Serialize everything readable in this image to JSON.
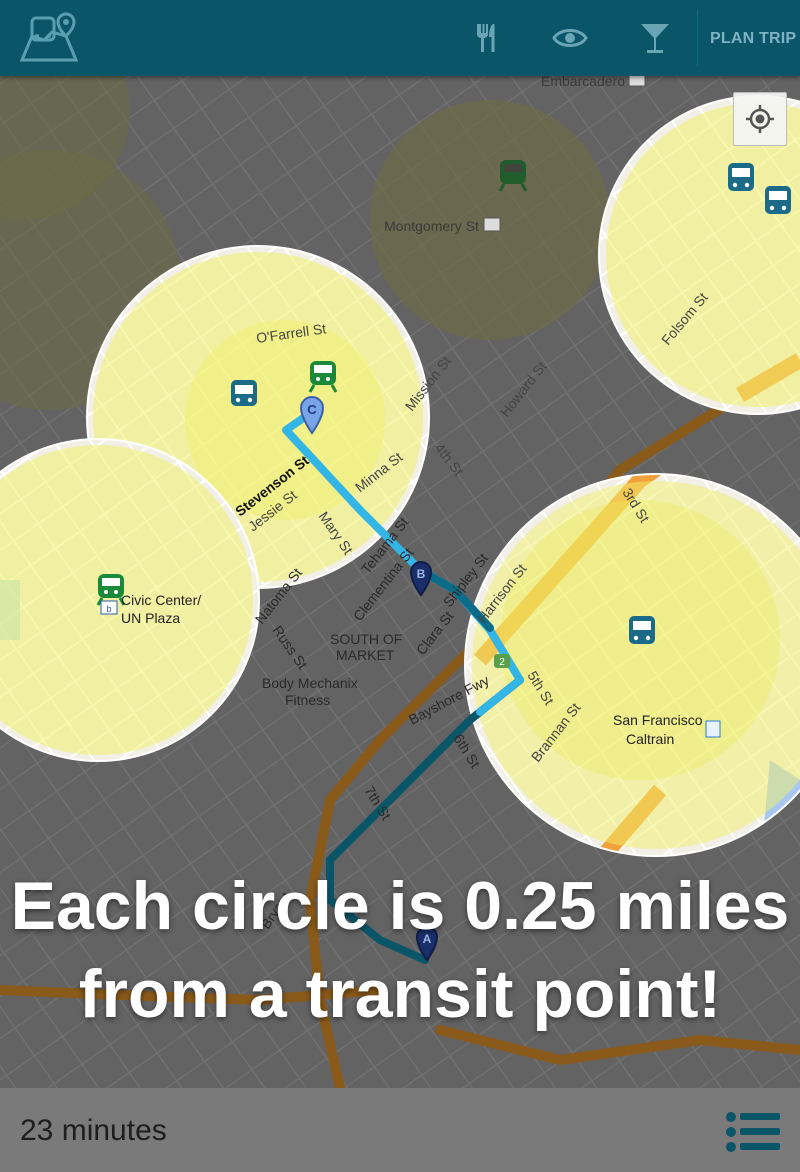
{
  "toolbar": {
    "logo_icon": "transit-map-logo-icon",
    "food_icon": "fork-knife-icon",
    "sights_icon": "eye-icon",
    "bars_icon": "cocktail-icon",
    "plan_trip_label": "PLAN TRIP"
  },
  "map": {
    "labels": {
      "embarcadero": "Embarcadero",
      "montgomery": "Montgomery St",
      "ofarrell": "O'Farrell St",
      "mission": "Mission St",
      "howard": "Howard St",
      "folsom": "Folsom St",
      "stevenson": "Stevenson St",
      "jessie": "Jessie St",
      "minna": "Minna St",
      "fourth": "4th St",
      "mary": "Mary St",
      "tehama": "Tehama St",
      "clementina": "Clementina St",
      "shipley": "Shipley St",
      "harrison": "Harrison St",
      "natoma": "Natoma St",
      "russ": "Russ St",
      "soma1": "SOUTH OF",
      "soma2": "MARKET",
      "clara": "Clara St",
      "third": "3rd St",
      "civic1": "Civic Center/",
      "civic2": "UN Plaza",
      "body1": "Body Mechanix",
      "body2": "Fitness",
      "bayshore": "Bayshore Fwy",
      "fifth": "5th St",
      "brannan": "Brannan St",
      "sixth": "6th St",
      "seventh": "7th St",
      "sf_caltrain1": "San Francisco",
      "sf_caltrain2": "Caltrain",
      "bryant": "Bryant",
      "hwy": "2"
    },
    "markers": [
      "A",
      "B",
      "C"
    ],
    "my_location_icon": "crosshair-location-icon",
    "colors": {
      "circle_fill": "#f0f06a",
      "route_light": "#33b5e5",
      "route_dark": "#0b5569",
      "freeway": "#e8871a",
      "bus_icon": "#1b6b88",
      "train_icon": "#1a8a3a"
    }
  },
  "caption": {
    "line1": "Each circle is 0.25 miles",
    "line2": "from a transit point!"
  },
  "footer": {
    "duration": "23 minutes",
    "list_icon": "list-icon"
  }
}
